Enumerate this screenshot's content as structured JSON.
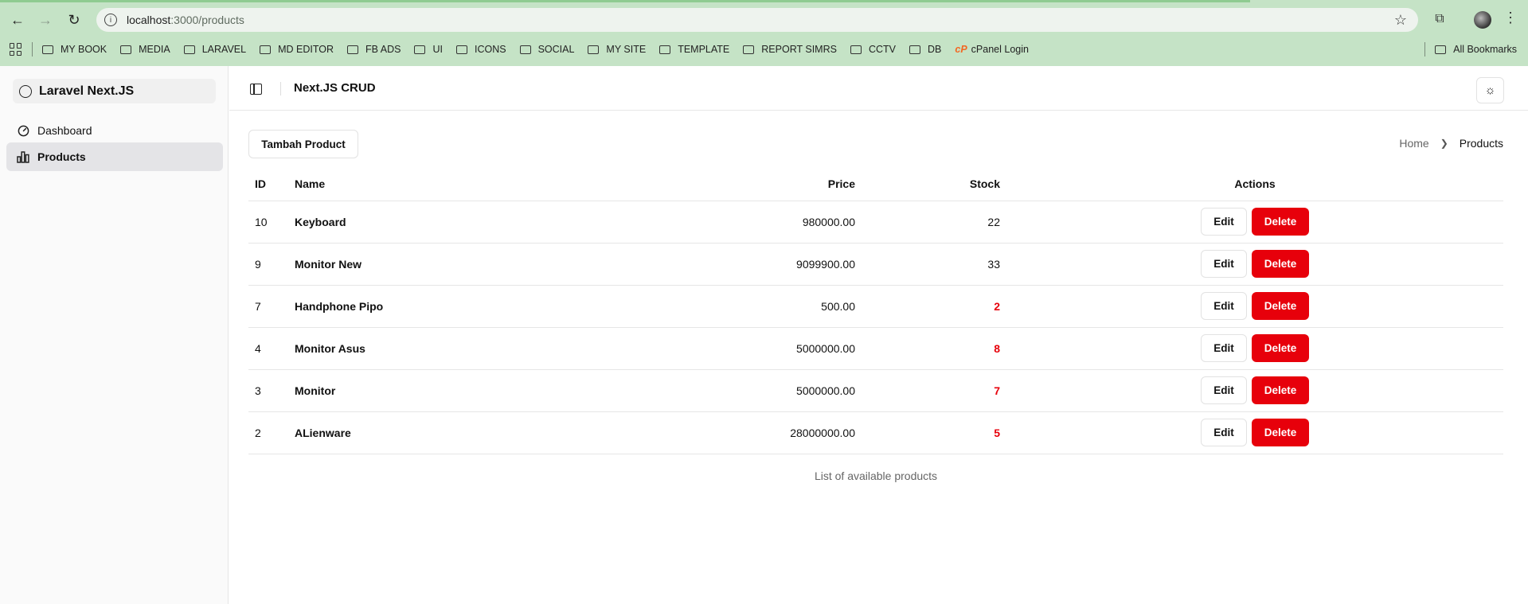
{
  "browser": {
    "url_host": "localhost",
    "url_rest": ":3000/products",
    "bookmarks": [
      "MY BOOK",
      "MEDIA",
      "LARAVEL",
      "MD EDITOR",
      "FB ADS",
      "UI",
      "ICONS",
      "SOCIAL",
      "MY SITE",
      "TEMPLATE",
      "REPORT SIMRS",
      "CCTV",
      "DB"
    ],
    "cpanel_label": "cPanel Login",
    "all_bookmarks": "All Bookmarks"
  },
  "sidebar": {
    "brand": "Laravel Next.JS",
    "items": [
      {
        "label": "Dashboard",
        "icon": "gauge-icon",
        "active": false
      },
      {
        "label": "Products",
        "icon": "bar-chart-icon",
        "active": true
      }
    ]
  },
  "header": {
    "title": "Next.JS CRUD"
  },
  "toolbar": {
    "add_label": "Tambah Product"
  },
  "breadcrumb": {
    "home": "Home",
    "current": "Products"
  },
  "table": {
    "headers": {
      "id": "ID",
      "name": "Name",
      "price": "Price",
      "stock": "Stock",
      "actions": "Actions"
    },
    "rows": [
      {
        "id": "10",
        "name": "Keyboard",
        "price": "980000.00",
        "stock": "22",
        "low": false
      },
      {
        "id": "9",
        "name": "Monitor New",
        "price": "9099900.00",
        "stock": "33",
        "low": false
      },
      {
        "id": "7",
        "name": "Handphone Pipo",
        "price": "500.00",
        "stock": "2",
        "low": true
      },
      {
        "id": "4",
        "name": "Monitor Asus",
        "price": "5000000.00",
        "stock": "8",
        "low": true
      },
      {
        "id": "3",
        "name": "Monitor",
        "price": "5000000.00",
        "stock": "7",
        "low": true
      },
      {
        "id": "2",
        "name": "ALienware",
        "price": "28000000.00",
        "stock": "5",
        "low": true
      }
    ],
    "edit_label": "Edit",
    "delete_label": "Delete",
    "caption": "List of available products"
  },
  "colors": {
    "danger": "#e7000b",
    "browser_chrome": "#c5e3c6"
  }
}
